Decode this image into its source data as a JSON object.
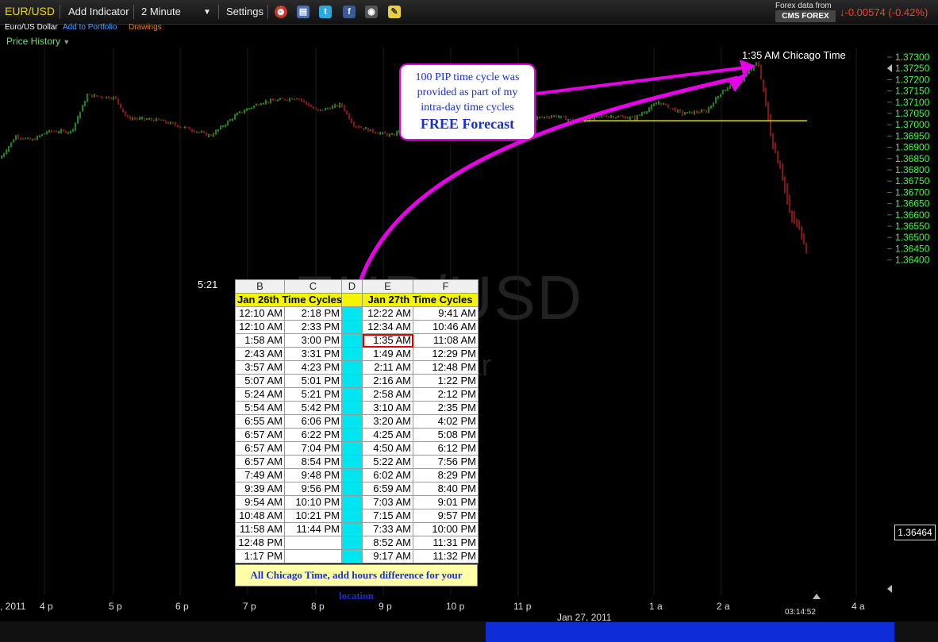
{
  "toolbar": {
    "symbol": "EUR/USD",
    "add_indicator": "Add Indicator",
    "interval": "2 Minute",
    "settings": "Settings",
    "forex_data_from": "Forex data from",
    "provider": "CMS FOREX",
    "change": "-0.00574 (-0.42%)"
  },
  "subbar": {
    "instrument_name": "Euro/US Dollar",
    "add_to_portfolio": "Add to Portfolio",
    "drawings": "Drawings"
  },
  "price_history": "Price History",
  "watermark": {
    "symbol": "EUR/USD",
    "name": "Dollar"
  },
  "annotations": {
    "top_label": "1:35 AM Chicago Time",
    "low_label": "5:21",
    "callout_lines": [
      "100 PIP time cycle was",
      "provided as part of my",
      "intra-day time cycles"
    ],
    "callout_bold": "FREE Forecast"
  },
  "colors": {
    "up": "#3dff3d",
    "down": "#ff2a2a",
    "arrow": "#e800e8",
    "axis_text": "#3cff3c",
    "level": "#d8d800"
  },
  "chart_data": {
    "type": "candlestick",
    "y_axis_labels": [
      "1.37300",
      "1.37250",
      "1.37200",
      "1.37150",
      "1.37100",
      "1.37050",
      "1.37000",
      "1.36950",
      "1.36900",
      "1.36850",
      "1.36800",
      "1.36750",
      "1.36700",
      "1.36650",
      "1.36600",
      "1.36550",
      "1.36500",
      "1.36450",
      "1.36400"
    ],
    "ylim": [
      1.36364,
      1.37322
    ],
    "x_axis_labels": [
      ", 2011",
      "4 p",
      "5 p",
      "6 p",
      "7 p",
      "8 p",
      "9 p",
      "10 p",
      "11 p",
      "Jan 27, 2011",
      "1 a",
      "2 a",
      "4 a"
    ],
    "last_price": "1.36464",
    "time_readout": "03:14:52",
    "horizontal_level": 1.37018
  },
  "table": {
    "col_letters": [
      "B",
      "C",
      "D",
      "E",
      "F"
    ],
    "title_left": "Jan 26th Time Cycles",
    "title_right": "Jan 27th Time Cycles",
    "rows": [
      [
        "12:10 AM",
        "2:18 PM",
        "12:22 AM",
        "9:41 AM"
      ],
      [
        "12:10 AM",
        "2:33 PM",
        "12:34 AM",
        "10:46 AM"
      ],
      [
        "1:58 AM",
        "3:00 PM",
        "1:35 AM",
        "11:08 AM"
      ],
      [
        "2:43 AM",
        "3:31 PM",
        "1:49 AM",
        "12:29 PM"
      ],
      [
        "3:57 AM",
        "4:23 PM",
        "2:11 AM",
        "12:48 PM"
      ],
      [
        "5:07 AM",
        "5:01 PM",
        "2:16 AM",
        "1:22 PM"
      ],
      [
        "5:24 AM",
        "5:21 PM",
        "2:58 AM",
        "2:12 PM"
      ],
      [
        "5:54 AM",
        "5:42 PM",
        "3:10 AM",
        "2:35 PM"
      ],
      [
        "6:55 AM",
        "6:06 PM",
        "3:20 AM",
        "4:02 PM"
      ],
      [
        "6:57 AM",
        "6:22 PM",
        "4:25 AM",
        "5:08 PM"
      ],
      [
        "6:57 AM",
        "7:04 PM",
        "4:50 AM",
        "6:12 PM"
      ],
      [
        "6:57 AM",
        "8:54 PM",
        "5:22 AM",
        "7:56 PM"
      ],
      [
        "7:49 AM",
        "9:48 PM",
        "6:02 AM",
        "8:29 PM"
      ],
      [
        "9:39 AM",
        "9:56 PM",
        "6:59 AM",
        "8:40 PM"
      ],
      [
        "9:54 AM",
        "10:10 PM",
        "7:03 AM",
        "9:01 PM"
      ],
      [
        "10:48 AM",
        "10:21 PM",
        "7:15 AM",
        "9:57 PM"
      ],
      [
        "11:58 AM",
        "11:44 PM",
        "7:33 AM",
        "10:00 PM"
      ],
      [
        "12:48 PM",
        "",
        "8:52 AM",
        "11:31 PM"
      ],
      [
        "1:17 PM",
        "",
        "9:17 AM",
        "11:32 PM"
      ]
    ],
    "highlight_cell": "1:35 AM",
    "footer_note": "All Chicago Time, add hours difference for your location"
  }
}
